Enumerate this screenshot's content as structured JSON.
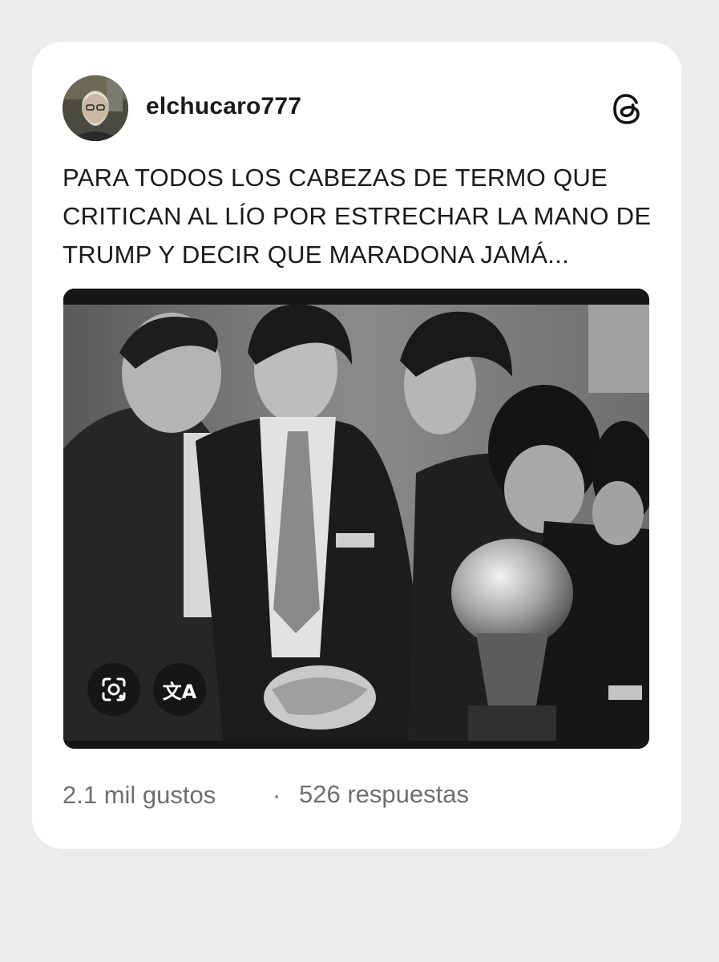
{
  "post": {
    "username": "elchucaro777",
    "text": "PARA TODOS LOS CABEZAS DE TERMO QUE CRITICAN AL LÍO POR ESTRECHAR LA MANO DE TRUMP Y DECIR QUE MARADONA JAMÁ...",
    "likes": "2.1 mil gustos",
    "separator": "·",
    "replies": "526 respuestas"
  },
  "icons": {
    "app": "threads-icon",
    "lens": "google-lens-icon",
    "translate": "translate-icon",
    "translate_glyph": "文A"
  },
  "colors": {
    "background": "#ececec",
    "card": "#ffffff",
    "text": "#1a1a1a",
    "muted": "#6f6f6f"
  }
}
